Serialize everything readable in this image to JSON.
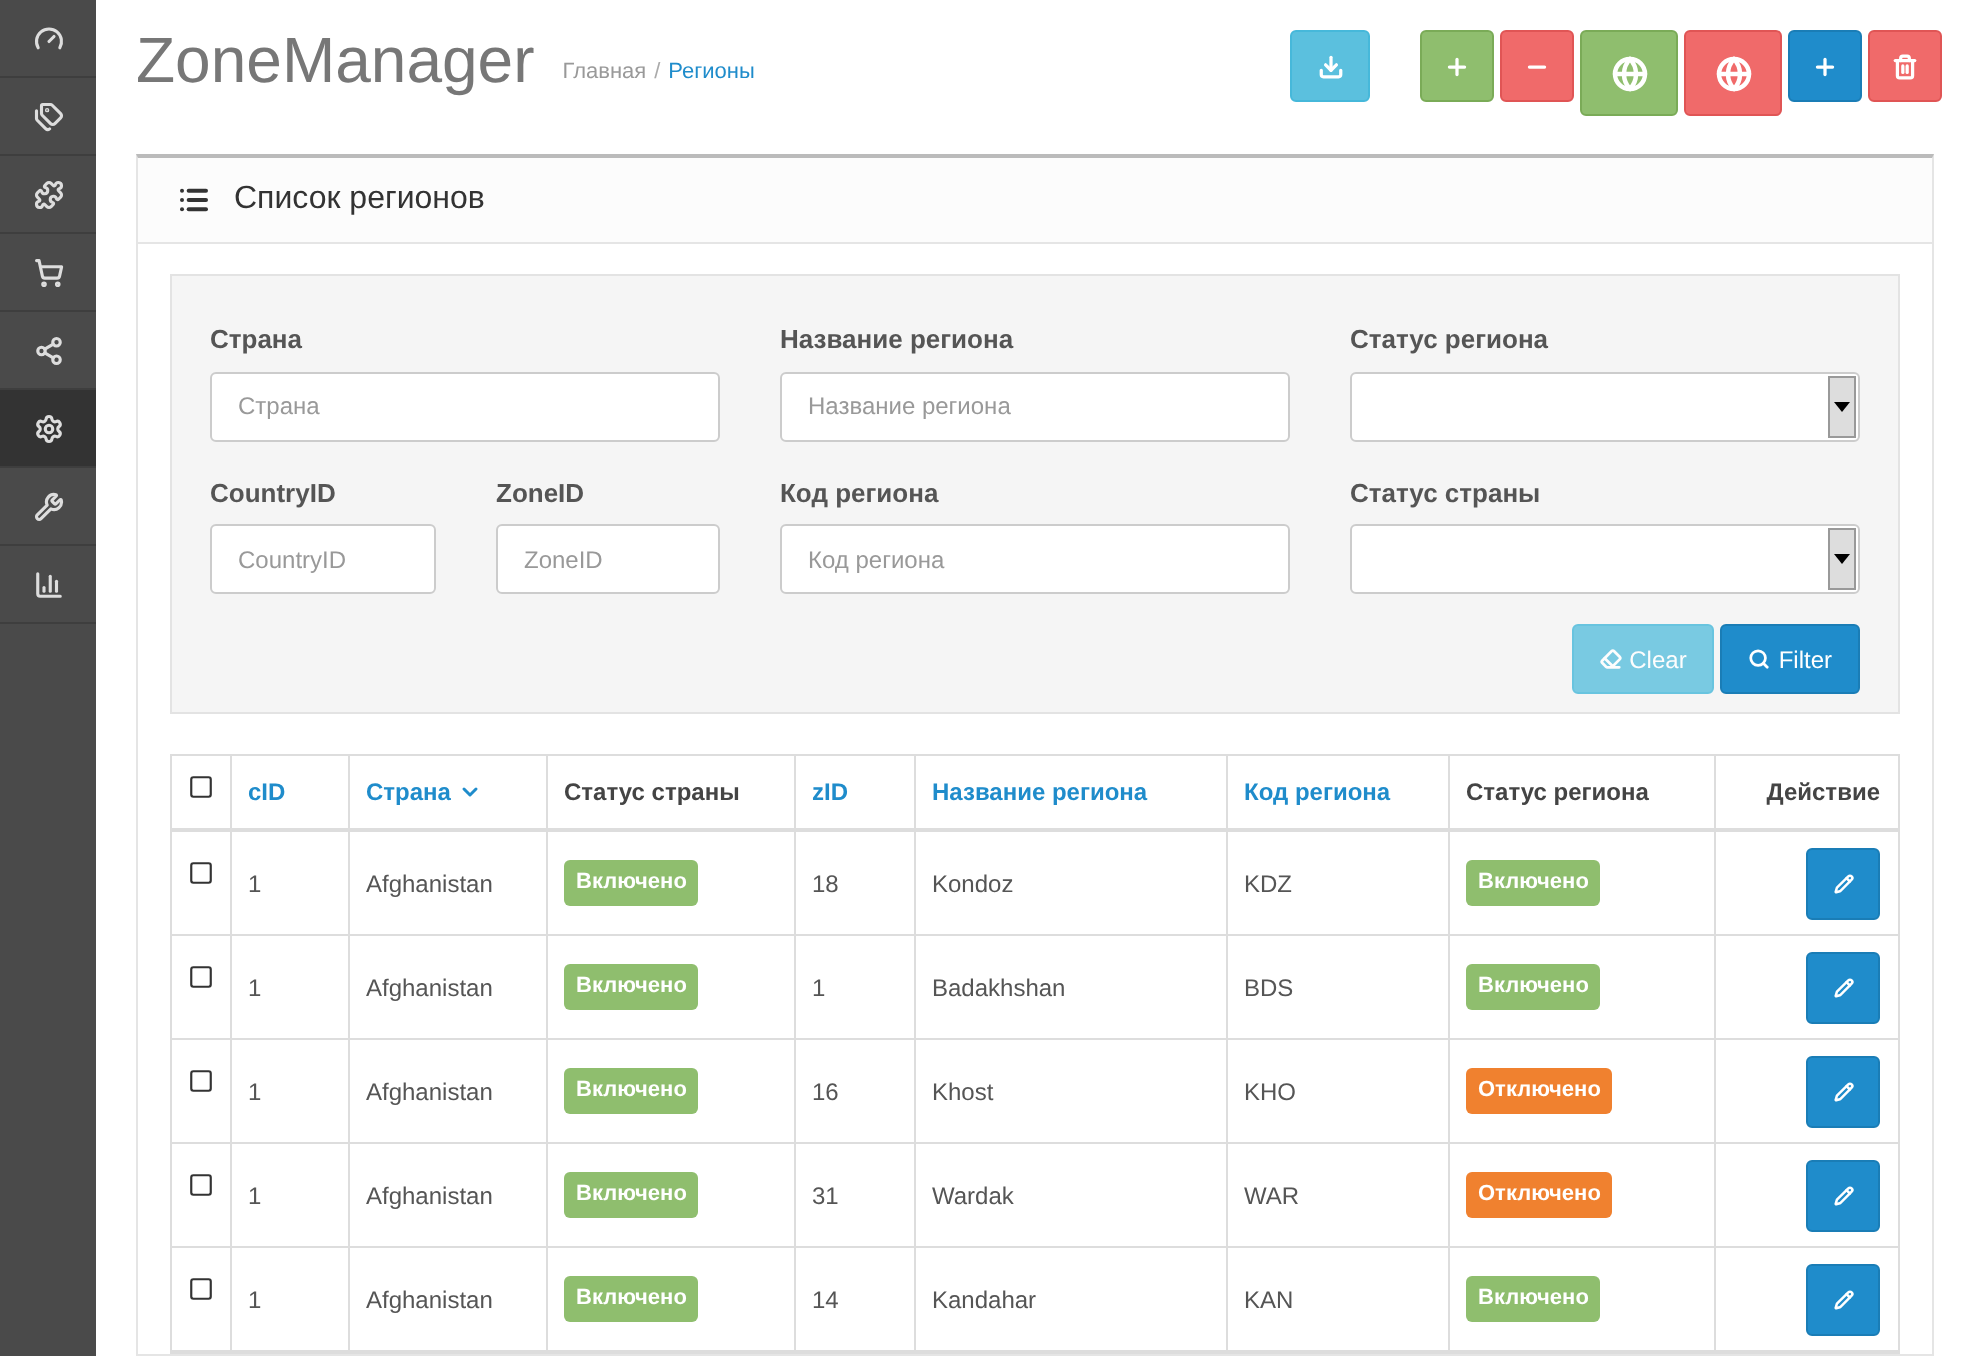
{
  "sidebar": {
    "items": [
      {
        "kind": "dashboard",
        "selected": false
      },
      {
        "kind": "tags",
        "selected": false
      },
      {
        "kind": "extensions",
        "selected": false
      },
      {
        "kind": "cart",
        "selected": false
      },
      {
        "kind": "share",
        "selected": false
      },
      {
        "kind": "settings",
        "selected": true
      },
      {
        "kind": "tools",
        "selected": false
      },
      {
        "kind": "reports",
        "selected": false
      }
    ]
  },
  "header": {
    "title": "ZoneManager",
    "separator": "/",
    "breadcrumbs": [
      {
        "label": "Главная",
        "selected": false
      },
      {
        "label": "Регионы",
        "selected": true
      }
    ]
  },
  "toolbar": [
    {
      "kind": "download"
    },
    {
      "kind": "gap"
    },
    {
      "kind": "enable"
    },
    {
      "kind": "disable"
    },
    {
      "kind": "globe-on"
    },
    {
      "kind": "globe-off"
    },
    {
      "kind": "add"
    },
    {
      "kind": "delete"
    }
  ],
  "panel": {
    "title": "Список регионов"
  },
  "filters": {
    "fields": [
      {
        "kind": "text",
        "label": "Страна",
        "placeholder": "Страна"
      },
      {
        "kind": "text",
        "label": "Название региона",
        "placeholder": "Название региона"
      },
      {
        "kind": "select",
        "label": "Статус региона"
      },
      {
        "kind": "text",
        "label": "CountryID",
        "placeholder": "CountryID"
      },
      {
        "kind": "text",
        "label": "ZoneID",
        "placeholder": "ZoneID"
      },
      {
        "kind": "text",
        "label": "Код региона",
        "placeholder": "Код региона"
      },
      {
        "kind": "select",
        "label": "Статус страны"
      }
    ],
    "buttons": [
      {
        "kind": "clear",
        "label": "Clear"
      },
      {
        "kind": "filter",
        "label": "Filter"
      }
    ]
  },
  "table": {
    "all_checked": false,
    "columns": [
      {
        "label": "cID",
        "sortable": true,
        "sorted": false
      },
      {
        "label": "Страна",
        "sortable": true,
        "sorted": true
      },
      {
        "label": "Статус страны",
        "sortable": false,
        "sorted": false
      },
      {
        "label": "zID",
        "sortable": true,
        "sorted": false
      },
      {
        "label": "Название региона",
        "sortable": true,
        "sorted": false
      },
      {
        "label": "Код региона",
        "sortable": true,
        "sorted": false
      },
      {
        "label": "Статус региона",
        "sortable": false,
        "sorted": false
      },
      {
        "label": "Действие",
        "sortable": false,
        "sorted": false
      }
    ],
    "rows": [
      {
        "checked": false,
        "cid": "1",
        "country": "Afghanistan",
        "country_status": {
          "label": "Включено",
          "enabled": true
        },
        "zid": "18",
        "name": "Kondoz",
        "code": "KDZ",
        "zone_status": {
          "label": "Включено",
          "enabled": true
        }
      },
      {
        "checked": false,
        "cid": "1",
        "country": "Afghanistan",
        "country_status": {
          "label": "Включено",
          "enabled": true
        },
        "zid": "1",
        "name": "Badakhshan",
        "code": "BDS",
        "zone_status": {
          "label": "Включено",
          "enabled": true
        }
      },
      {
        "checked": false,
        "cid": "1",
        "country": "Afghanistan",
        "country_status": {
          "label": "Включено",
          "enabled": true
        },
        "zid": "16",
        "name": "Khost",
        "code": "KHO",
        "zone_status": {
          "label": "Отключено",
          "enabled": false
        }
      },
      {
        "checked": false,
        "cid": "1",
        "country": "Afghanistan",
        "country_status": {
          "label": "Включено",
          "enabled": true
        },
        "zid": "31",
        "name": "Wardak",
        "code": "WAR",
        "zone_status": {
          "label": "Отключено",
          "enabled": false
        }
      },
      {
        "checked": false,
        "cid": "1",
        "country": "Afghanistan",
        "country_status": {
          "label": "Включено",
          "enabled": true
        },
        "zid": "14",
        "name": "Kandahar",
        "code": "KAN",
        "zone_status": {
          "label": "Включено",
          "enabled": true
        }
      }
    ]
  }
}
